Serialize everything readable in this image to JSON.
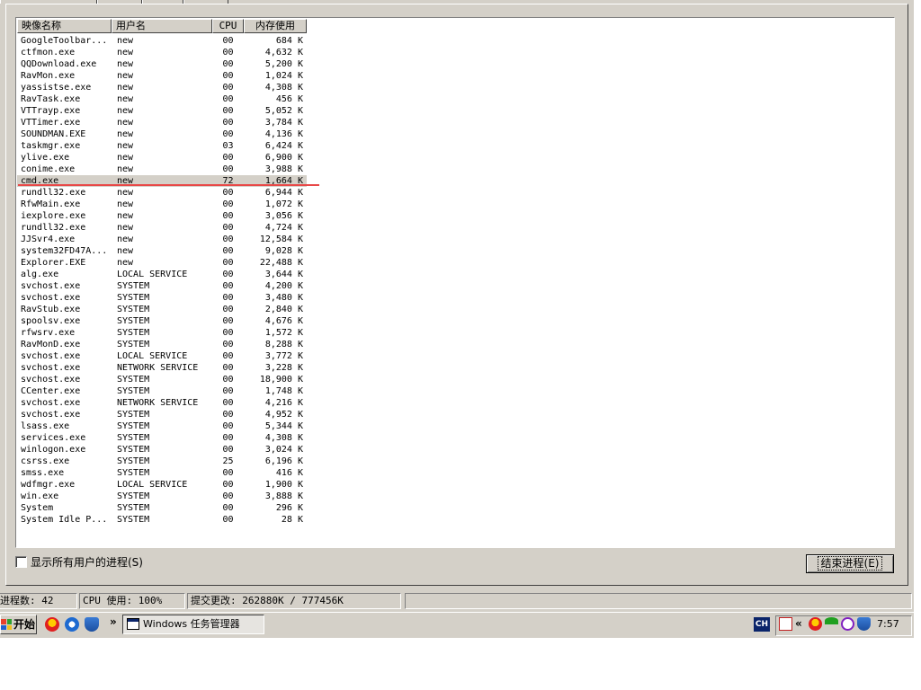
{
  "columns": [
    {
      "label": "映像名称"
    },
    {
      "label": "用户名"
    },
    {
      "label": "CPU"
    },
    {
      "label": "内存使用"
    }
  ],
  "processes": [
    {
      "image": "GoogleToolbar...",
      "user": "new",
      "cpu": "00",
      "mem": "684 K"
    },
    {
      "image": "ctfmon.exe",
      "user": "new",
      "cpu": "00",
      "mem": "4,632 K"
    },
    {
      "image": "QQDownload.exe",
      "user": "new",
      "cpu": "00",
      "mem": "5,200 K"
    },
    {
      "image": "RavMon.exe",
      "user": "new",
      "cpu": "00",
      "mem": "1,024 K"
    },
    {
      "image": "yassistse.exe",
      "user": "new",
      "cpu": "00",
      "mem": "4,308 K"
    },
    {
      "image": "RavTask.exe",
      "user": "new",
      "cpu": "00",
      "mem": "456 K"
    },
    {
      "image": "VTTrayp.exe",
      "user": "new",
      "cpu": "00",
      "mem": "5,052 K"
    },
    {
      "image": "VTTimer.exe",
      "user": "new",
      "cpu": "00",
      "mem": "3,784 K"
    },
    {
      "image": "SOUNDMAN.EXE",
      "user": "new",
      "cpu": "00",
      "mem": "4,136 K"
    },
    {
      "image": "taskmgr.exe",
      "user": "new",
      "cpu": "03",
      "mem": "6,424 K"
    },
    {
      "image": "ylive.exe",
      "user": "new",
      "cpu": "00",
      "mem": "6,900 K"
    },
    {
      "image": "conime.exe",
      "user": "new",
      "cpu": "00",
      "mem": "3,988 K"
    },
    {
      "image": "cmd.exe",
      "user": "new",
      "cpu": "72",
      "mem": "1,664 K"
    },
    {
      "image": "rundll32.exe",
      "user": "new",
      "cpu": "00",
      "mem": "6,944 K"
    },
    {
      "image": "RfwMain.exe",
      "user": "new",
      "cpu": "00",
      "mem": "1,072 K"
    },
    {
      "image": "iexplore.exe",
      "user": "new",
      "cpu": "00",
      "mem": "3,056 K"
    },
    {
      "image": "rundll32.exe",
      "user": "new",
      "cpu": "00",
      "mem": "4,724 K"
    },
    {
      "image": "JJSvr4.exe",
      "user": "new",
      "cpu": "00",
      "mem": "12,584 K"
    },
    {
      "image": "system32FD47A...",
      "user": "new",
      "cpu": "00",
      "mem": "9,028 K"
    },
    {
      "image": "Explorer.EXE",
      "user": "new",
      "cpu": "00",
      "mem": "22,488 K"
    },
    {
      "image": "alg.exe",
      "user": "LOCAL SERVICE",
      "cpu": "00",
      "mem": "3,644 K"
    },
    {
      "image": "svchost.exe",
      "user": "SYSTEM",
      "cpu": "00",
      "mem": "4,200 K"
    },
    {
      "image": "svchost.exe",
      "user": "SYSTEM",
      "cpu": "00",
      "mem": "3,480 K"
    },
    {
      "image": "RavStub.exe",
      "user": "SYSTEM",
      "cpu": "00",
      "mem": "2,840 K"
    },
    {
      "image": "spoolsv.exe",
      "user": "SYSTEM",
      "cpu": "00",
      "mem": "4,676 K"
    },
    {
      "image": "rfwsrv.exe",
      "user": "SYSTEM",
      "cpu": "00",
      "mem": "1,572 K"
    },
    {
      "image": "RavMonD.exe",
      "user": "SYSTEM",
      "cpu": "00",
      "mem": "8,288 K"
    },
    {
      "image": "svchost.exe",
      "user": "LOCAL SERVICE",
      "cpu": "00",
      "mem": "3,772 K"
    },
    {
      "image": "svchost.exe",
      "user": "NETWORK SERVICE",
      "cpu": "00",
      "mem": "3,228 K"
    },
    {
      "image": "svchost.exe",
      "user": "SYSTEM",
      "cpu": "00",
      "mem": "18,900 K"
    },
    {
      "image": "CCenter.exe",
      "user": "SYSTEM",
      "cpu": "00",
      "mem": "1,748 K"
    },
    {
      "image": "svchost.exe",
      "user": "NETWORK SERVICE",
      "cpu": "00",
      "mem": "4,216 K"
    },
    {
      "image": "svchost.exe",
      "user": "SYSTEM",
      "cpu": "00",
      "mem": "4,952 K"
    },
    {
      "image": "lsass.exe",
      "user": "SYSTEM",
      "cpu": "00",
      "mem": "5,344 K"
    },
    {
      "image": "services.exe",
      "user": "SYSTEM",
      "cpu": "00",
      "mem": "4,308 K"
    },
    {
      "image": "winlogon.exe",
      "user": "SYSTEM",
      "cpu": "00",
      "mem": "3,024 K"
    },
    {
      "image": "csrss.exe",
      "user": "SYSTEM",
      "cpu": "25",
      "mem": "6,196 K"
    },
    {
      "image": "smss.exe",
      "user": "SYSTEM",
      "cpu": "00",
      "mem": "416 K"
    },
    {
      "image": "wdfmgr.exe",
      "user": "LOCAL SERVICE",
      "cpu": "00",
      "mem": "1,900 K"
    },
    {
      "image": "win.exe",
      "user": "SYSTEM",
      "cpu": "00",
      "mem": "3,888 K"
    },
    {
      "image": "System",
      "user": "SYSTEM",
      "cpu": "00",
      "mem": "296 K"
    },
    {
      "image": "System Idle P...",
      "user": "SYSTEM",
      "cpu": "00",
      "mem": "28 K"
    }
  ],
  "selected_image": "cmd.exe",
  "show_all_users": {
    "label": "显示所有用户的进程(S)",
    "checked": false
  },
  "end_process_button": "结束进程(E)",
  "status": {
    "processes": "进程数: 42",
    "cpu": "CPU 使用: 100%",
    "commit": "提交更改: 262880K / 777456K"
  },
  "taskbar": {
    "start_label": "开始",
    "chevron": "»",
    "task_button": "Windows 任务管理器",
    "ime": "CH",
    "tray_chevron": "«",
    "clock": "7:57"
  },
  "colors": {
    "face": "#d4d0c8",
    "selection": "#d4d0c8",
    "annotation_line": "#e84848",
    "title_blue": "#0a246a"
  },
  "icons": {
    "start": "windows-flag-icon",
    "quicklaunch": [
      "qq-icon",
      "internet-explorer-icon",
      "rising-firewall-icon"
    ],
    "task": "task-manager-icon",
    "tray": [
      "red-document-icon",
      "qq-tray-icon",
      "umbrella-icon",
      "clock-circle-icon",
      "shield-tray-icon"
    ]
  }
}
